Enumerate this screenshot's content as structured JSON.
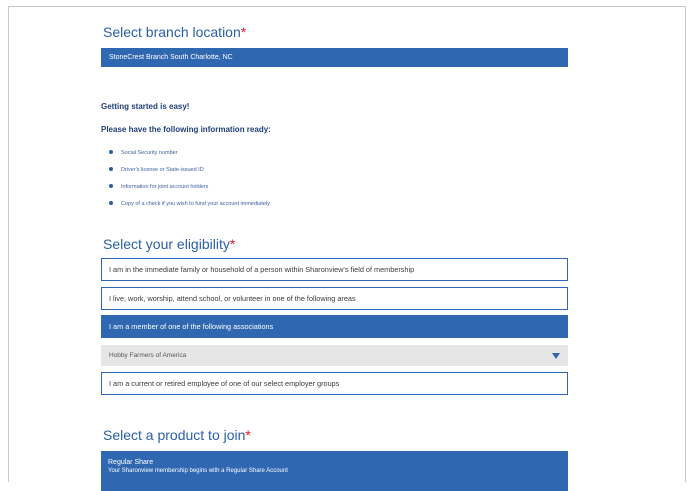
{
  "branch": {
    "title": "Select branch location",
    "required_mark": "*",
    "selected": "StoneCrest Branch South Charlotte, NC"
  },
  "info": {
    "heading1": "Getting started is easy!",
    "heading2": "Please have the following information ready:",
    "items": [
      "Social Security number",
      "Driver's license or State-issued ID",
      "Information for joint account holders",
      "Copy of a check if you wish to fund your account immediately"
    ]
  },
  "eligibility": {
    "title": "Select your eligibility",
    "required_mark": "*",
    "options": [
      "I am in the immediate family or household of a person within Sharonview's field of membership",
      "I live, work, worship, attend school, or volunteer in one of the following areas",
      "I am a member of one of the following associations",
      "I am a current or retired employee of one of our select employer groups"
    ],
    "association_dropdown": "Hobby Farmers of America"
  },
  "product": {
    "title": "Select a product to join",
    "required_mark": "*",
    "selected_name": "Regular Share",
    "selected_desc": "Your Sharonview membership begins with a Regular Share Account"
  },
  "colors": {
    "accent": "#2f67b1",
    "title": "#2a5fa8",
    "required": "#e02020"
  }
}
